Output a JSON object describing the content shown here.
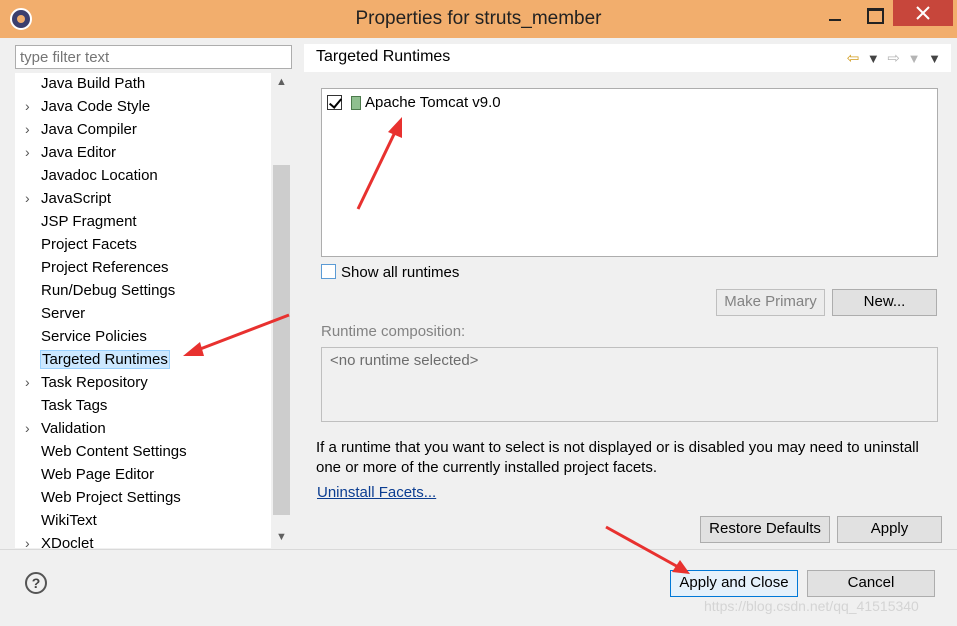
{
  "window": {
    "title": "Properties for struts_member"
  },
  "filter": {
    "placeholder": "type filter text"
  },
  "tree": {
    "items": [
      {
        "label": "Java Build Path",
        "expandable": false
      },
      {
        "label": "Java Code Style",
        "expandable": true
      },
      {
        "label": "Java Compiler",
        "expandable": true
      },
      {
        "label": "Java Editor",
        "expandable": true
      },
      {
        "label": "Javadoc Location",
        "expandable": false
      },
      {
        "label": "JavaScript",
        "expandable": true
      },
      {
        "label": "JSP Fragment",
        "expandable": false
      },
      {
        "label": "Project Facets",
        "expandable": false
      },
      {
        "label": "Project References",
        "expandable": false
      },
      {
        "label": "Run/Debug Settings",
        "expandable": false
      },
      {
        "label": "Server",
        "expandable": false
      },
      {
        "label": "Service Policies",
        "expandable": false
      },
      {
        "label": "Targeted Runtimes",
        "expandable": false,
        "selected": true
      },
      {
        "label": "Task Repository",
        "expandable": true
      },
      {
        "label": "Task Tags",
        "expandable": false
      },
      {
        "label": "Validation",
        "expandable": true
      },
      {
        "label": "Web Content Settings",
        "expandable": false
      },
      {
        "label": "Web Page Editor",
        "expandable": false
      },
      {
        "label": "Web Project Settings",
        "expandable": false
      },
      {
        "label": "WikiText",
        "expandable": false
      },
      {
        "label": "XDoclet",
        "expandable": true
      }
    ]
  },
  "page": {
    "title": "Targeted Runtimes"
  },
  "runtimes": {
    "items": [
      {
        "label": "Apache Tomcat v9.0",
        "checked": true
      }
    ],
    "show_all_label": "Show all runtimes",
    "make_primary_label": "Make Primary",
    "new_label": "New...",
    "composition_label": "Runtime composition:",
    "composition_value": "<no runtime selected>",
    "info_text": "If a runtime that you want to select is not displayed or is disabled you may need to uninstall one or more of the currently installed project facets.",
    "uninstall_link": "Uninstall Facets...",
    "restore_defaults_label": "Restore Defaults",
    "apply_label": "Apply"
  },
  "footer": {
    "help_glyph": "?",
    "apply_close_label": "Apply and Close",
    "cancel_label": "Cancel",
    "watermark": "https://blog.csdn.net/qq_41515340"
  },
  "colors": {
    "titlebar": "#f2ae6d",
    "close_button": "#c7463b",
    "selection": "#cce8ff",
    "annotation_arrow": "#e8312f"
  }
}
